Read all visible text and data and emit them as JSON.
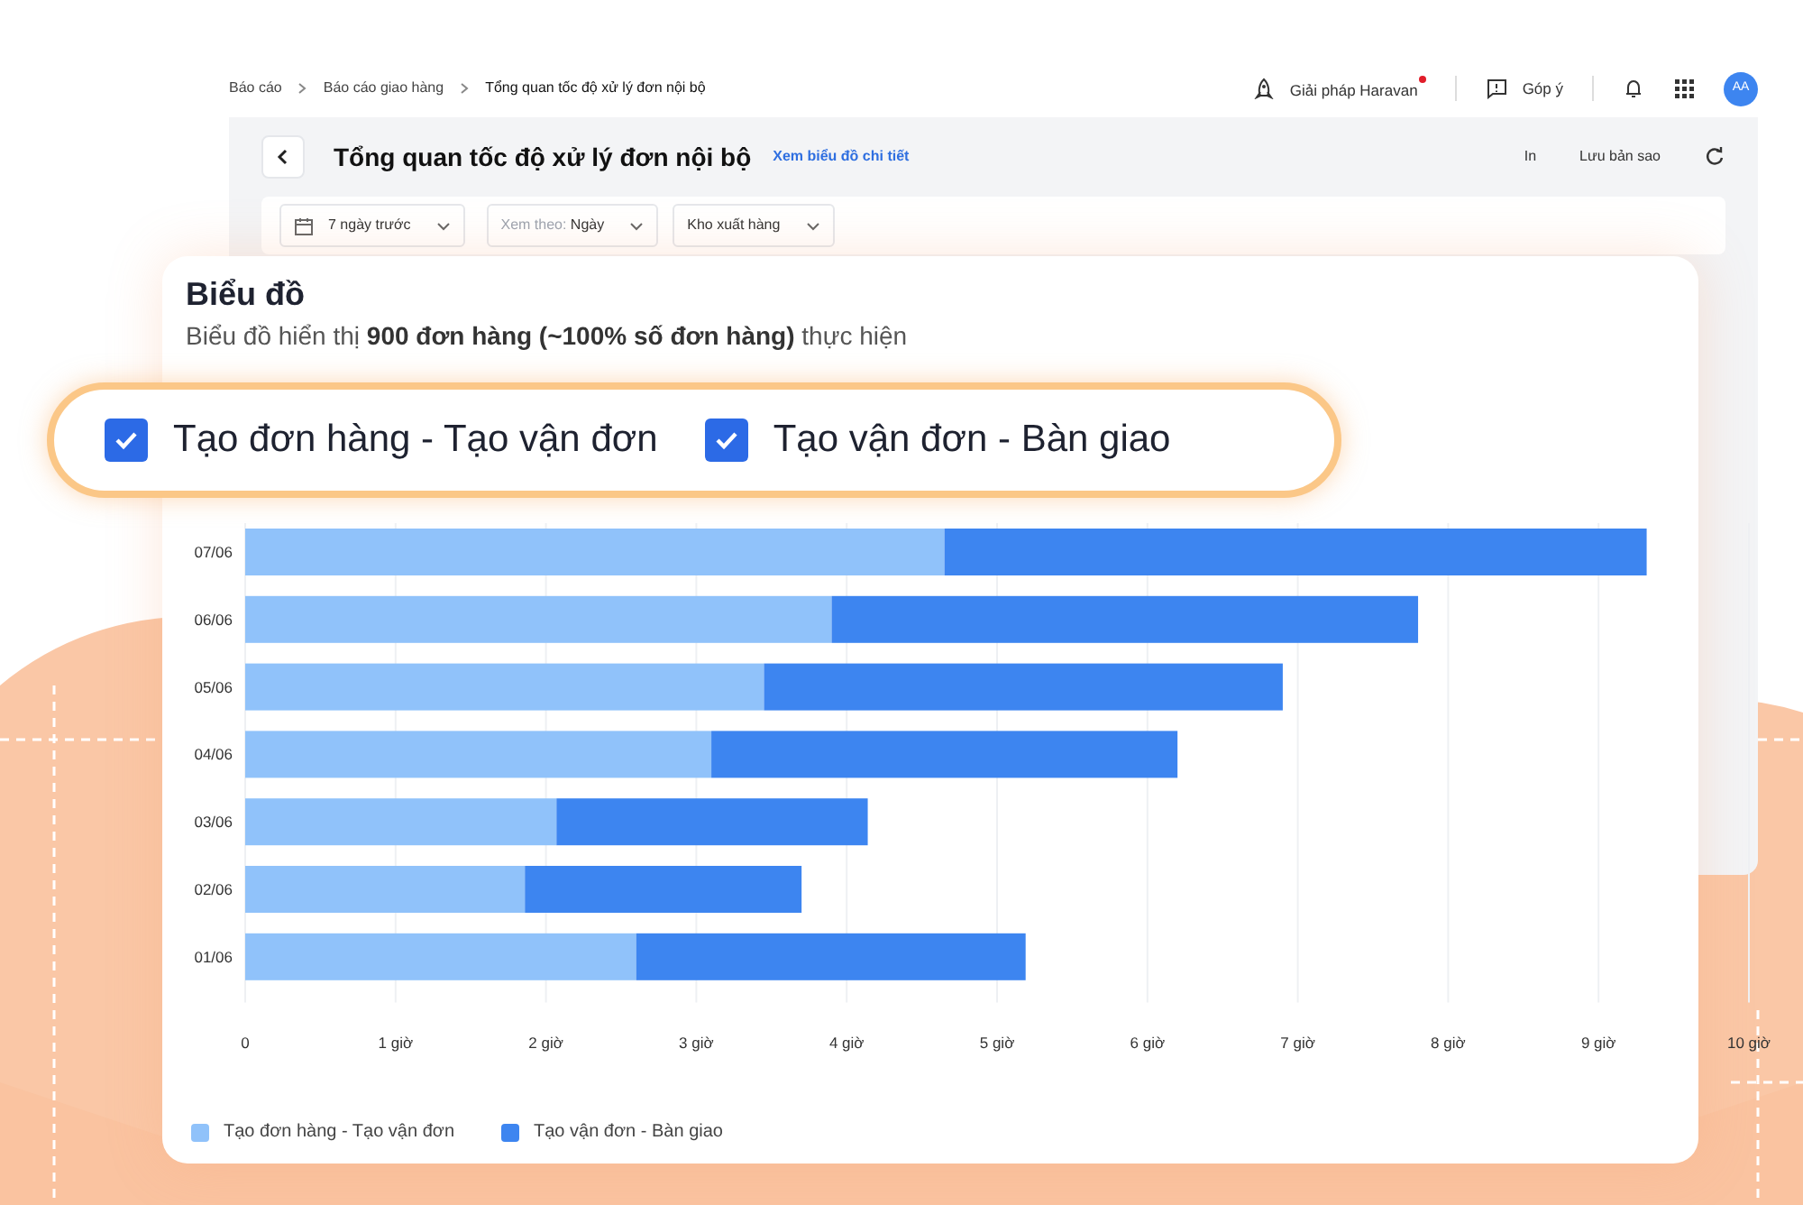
{
  "breadcrumb": [
    "Báo cáo",
    "Báo cáo giao hàng",
    "Tổng quan tốc độ xử lý đơn nội bộ"
  ],
  "header_actions": [
    {
      "kind": "rocket",
      "label": "Giải pháp Haravan",
      "badge": true
    },
    {
      "kind": "feedback",
      "label": "Góp ý",
      "badge": false
    }
  ],
  "avatar": "AA",
  "report": {
    "title": "Tổng quan tốc độ xử lý đơn nội bộ",
    "link": "Xem biểu đồ chi tiết",
    "actions": [
      "In",
      "Lưu bản sao"
    ]
  },
  "filters": [
    {
      "kind": "date",
      "value": "7 ngày trước"
    },
    {
      "kind": "select",
      "label": "Xem theo:",
      "value": "Ngày"
    },
    {
      "kind": "select",
      "value": "Kho xuất hàng"
    }
  ],
  "chart_card": {
    "title": "Biểu đồ",
    "subtitle": "Biểu đồ hiển thị **900 đơn hàng (~100% số đơn hàng)** thực hiện"
  },
  "toggles": [
    {
      "label": "Tạo đơn hàng - Tạo vận đơn",
      "checked": true
    },
    {
      "label": "Tạo vận đơn - Bàn giao",
      "checked": true
    }
  ],
  "chart_data": {
    "type": "bar",
    "orientation": "horizontal",
    "stacked": true,
    "categories": [
      "07/06",
      "06/06",
      "05/06",
      "04/06",
      "03/06",
      "02/06",
      "01/06"
    ],
    "series": [
      {
        "name": "Tạo đơn hàng - Tạo vận đơn",
        "color": "#90c2fa",
        "values": [
          4.65,
          3.9,
          3.45,
          3.1,
          2.07,
          1.86,
          2.6
        ]
      },
      {
        "name": "Tạo vận đơn - Bàn giao",
        "color": "#3d85f0",
        "values": [
          4.67,
          3.9,
          3.45,
          3.1,
          2.07,
          1.84,
          2.59
        ]
      }
    ],
    "xlim": [
      0,
      10
    ],
    "grid": true,
    "xticks": [
      0,
      {
        "value": 1,
        "label": "1 giờ"
      },
      {
        "value": 2,
        "label": "2 giờ"
      },
      {
        "value": 3,
        "label": "3 giờ"
      },
      {
        "value": 4,
        "label": "4 giờ"
      },
      {
        "value": 5,
        "label": "5 giờ"
      },
      {
        "value": 6,
        "label": "6 giờ"
      },
      {
        "value": 7,
        "label": "7 giờ"
      },
      {
        "value": 8,
        "label": "8 giờ"
      },
      {
        "value": 9,
        "label": "9 giờ"
      },
      {
        "value": 10,
        "label": "10 giờ"
      }
    ]
  }
}
